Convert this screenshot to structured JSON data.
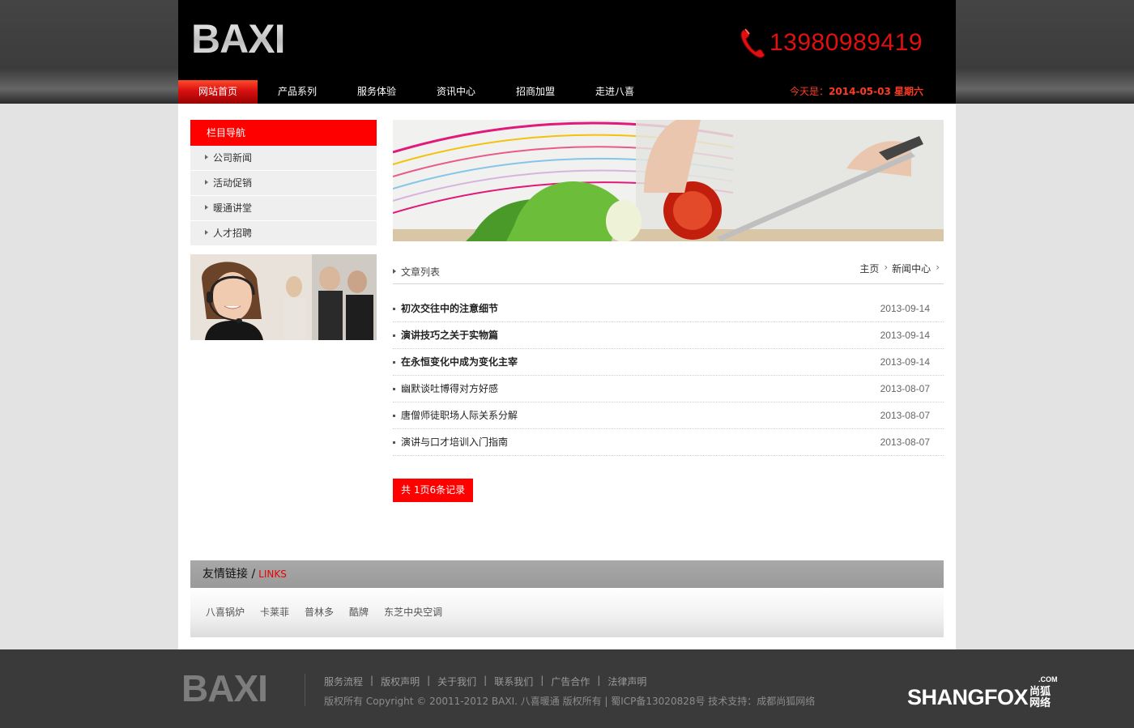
{
  "header": {
    "logo": "BAXI",
    "phone": "13980989419",
    "nav": [
      "网站首页",
      "产品系列",
      "服务体验",
      "资讯中心",
      "招商加盟",
      "走进八喜"
    ],
    "date_prefix": "今天是：",
    "date": "2014-05-03 星期六"
  },
  "sidebar": {
    "title": "栏目导航",
    "items": [
      "公司新闻",
      "活动促销",
      "暖通讲堂",
      "人才招聘"
    ]
  },
  "main": {
    "list_title": "文章列表",
    "breadcrumb": [
      "主页",
      "新闻中心"
    ],
    "articles": [
      {
        "title": "初次交往中的注意细节",
        "date": "2013-09-14"
      },
      {
        "title": "演讲技巧之关于实物篇",
        "date": "2013-09-14"
      },
      {
        "title": "在永恒变化中成为变化主宰",
        "date": "2013-09-14"
      },
      {
        "title": "幽默谈吐博得对方好感",
        "date": "2013-08-07"
      },
      {
        "title": "唐僧师徒职场人际关系分解",
        "date": "2013-08-07"
      },
      {
        "title": "演讲与口才培训入门指南",
        "date": "2013-08-07"
      }
    ],
    "pager": "共 1页6条记录"
  },
  "links": {
    "title": "友情链接 /",
    "title_en": "LINKS",
    "items": [
      "八喜锅炉",
      "卡莱菲",
      "普林多",
      "酷牌",
      "东芝中央空调"
    ]
  },
  "footer": {
    "logo": "BAXI",
    "links": [
      "服务流程",
      "版权声明",
      "关于我们",
      "联系我们",
      "广告合作",
      "法律声明"
    ],
    "separator": "|",
    "copyright": "版权所有 Copyright © 20011-2012 BAXI. 八喜暖通 版权所有 | 蜀ICP备13020828号 技术支持：成都尚狐网络",
    "brand": "SHANGFOX",
    "brand_com": ".COM",
    "brand_cn": "尚狐网络"
  },
  "colors": {
    "accent": "#ff0000",
    "header_bg": "#000000",
    "phone": "#e01010"
  }
}
